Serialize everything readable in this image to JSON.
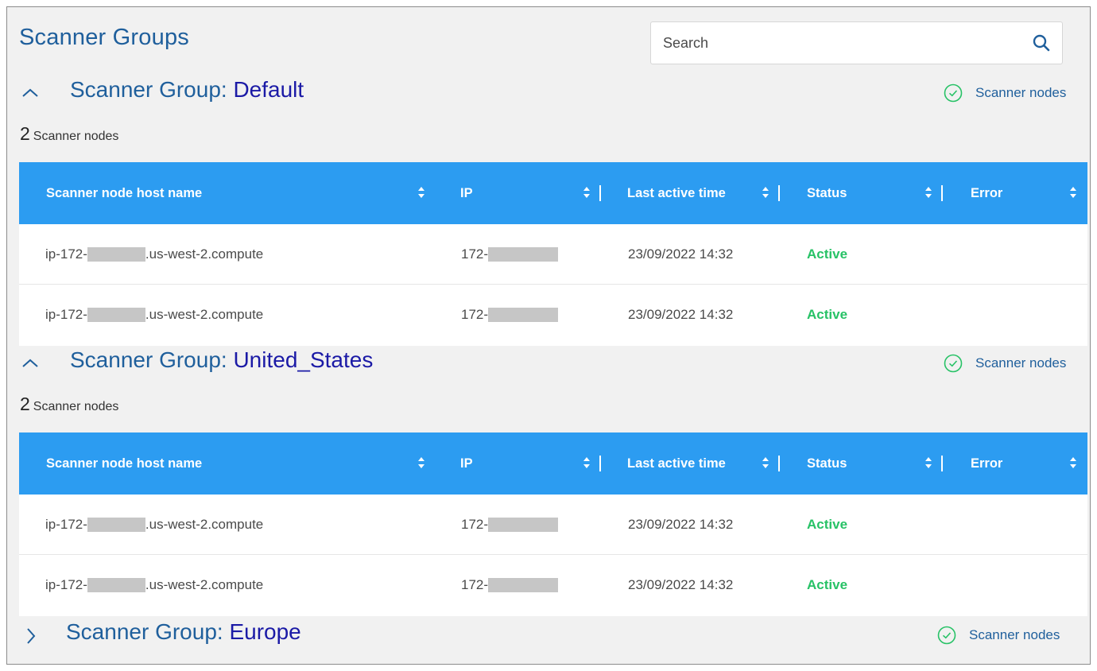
{
  "page": {
    "title": "Scanner Groups"
  },
  "search": {
    "placeholder": "Search"
  },
  "colors": {
    "header_bg": "#2c9cf1",
    "group_name": "#1b1aa6",
    "title_text": "#1f5f9c",
    "status_active": "#27c266"
  },
  "icons": {
    "search": "search-icon",
    "expanded": "chevron-up-icon",
    "collapsed": "chevron-right-icon",
    "scanner_nodes": "check-circle-icon",
    "sort": "sort-icon"
  },
  "table_columns": {
    "host": "Scanner node host name",
    "ip": "IP",
    "last_active": "Last active time",
    "status": "Status",
    "error": "Error"
  },
  "groups": [
    {
      "label": "Scanner Group: ",
      "name": "Default",
      "expanded": true,
      "scanner_nodes_link": "Scanner nodes",
      "node_count": "2",
      "node_count_label": "Scanner nodes",
      "rows": [
        {
          "host_prefix": "ip-172-",
          "host_suffix": ".us-west-2.compute",
          "ip_prefix": "172-",
          "last_active": "23/09/2022 14:32",
          "status": "Active",
          "error": ""
        },
        {
          "host_prefix": "ip-172-",
          "host_suffix": ".us-west-2.compute",
          "ip_prefix": "172-",
          "last_active": "23/09/2022 14:32",
          "status": "Active",
          "error": ""
        }
      ]
    },
    {
      "label": "Scanner Group: ",
      "name": "United_States",
      "expanded": true,
      "scanner_nodes_link": "Scanner nodes",
      "node_count": "2",
      "node_count_label": "Scanner nodes",
      "rows": [
        {
          "host_prefix": "ip-172-",
          "host_suffix": ".us-west-2.compute",
          "ip_prefix": "172-",
          "last_active": "23/09/2022 14:32",
          "status": "Active",
          "error": ""
        },
        {
          "host_prefix": "ip-172-",
          "host_suffix": ".us-west-2.compute",
          "ip_prefix": "172-",
          "last_active": "23/09/2022 14:32",
          "status": "Active",
          "error": ""
        }
      ]
    },
    {
      "label": "Scanner Group: ",
      "name": "Europe",
      "expanded": false,
      "scanner_nodes_link": "Scanner nodes"
    }
  ]
}
